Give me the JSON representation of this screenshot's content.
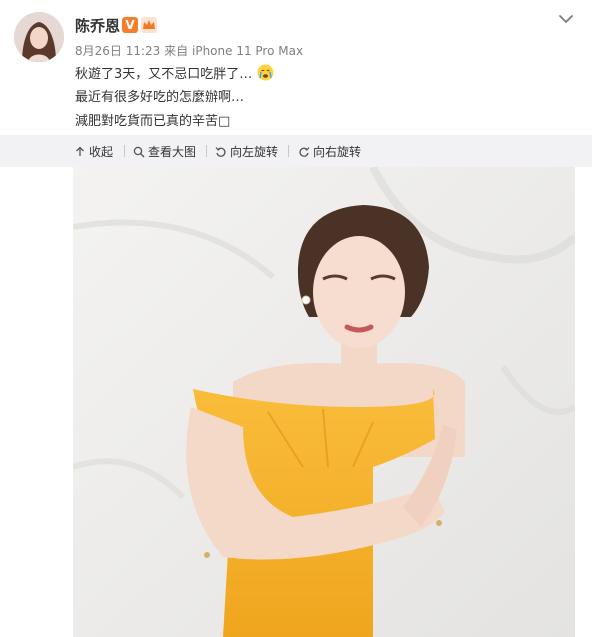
{
  "user": {
    "name": "陈乔恩",
    "verified_badge": "V",
    "avatar": "avatar-photo"
  },
  "meta": {
    "date": "8月26日",
    "time": "11:23",
    "source_prefix": "来自",
    "source": "iPhone 11 Pro Max"
  },
  "post": {
    "line1": "秋遊了3天，又不忌口吃胖了…",
    "line2": "最近有很多好吃的怎麼辦啊…",
    "line3": "減肥對吃貨而已真的辛苦",
    "line3_tail": "□"
  },
  "toolbar": {
    "collapse": "收起",
    "view_large": "查看大图",
    "rotate_left": "向左旋转",
    "rotate_right": "向右旋转"
  },
  "icons": {
    "collapse": "collapse-up-icon",
    "view_large": "magnifier-icon",
    "rotate_left": "rotate-left-icon",
    "rotate_right": "rotate-right-icon",
    "menu": "chevron-down-icon",
    "emoji": "crying-face-emoji-icon",
    "member": "crown-icon"
  },
  "colors": {
    "accent": "#f57e2a",
    "toolbar_bg": "#f2f2f5",
    "meta_text": "#808080",
    "dress": "#f6b12a"
  }
}
